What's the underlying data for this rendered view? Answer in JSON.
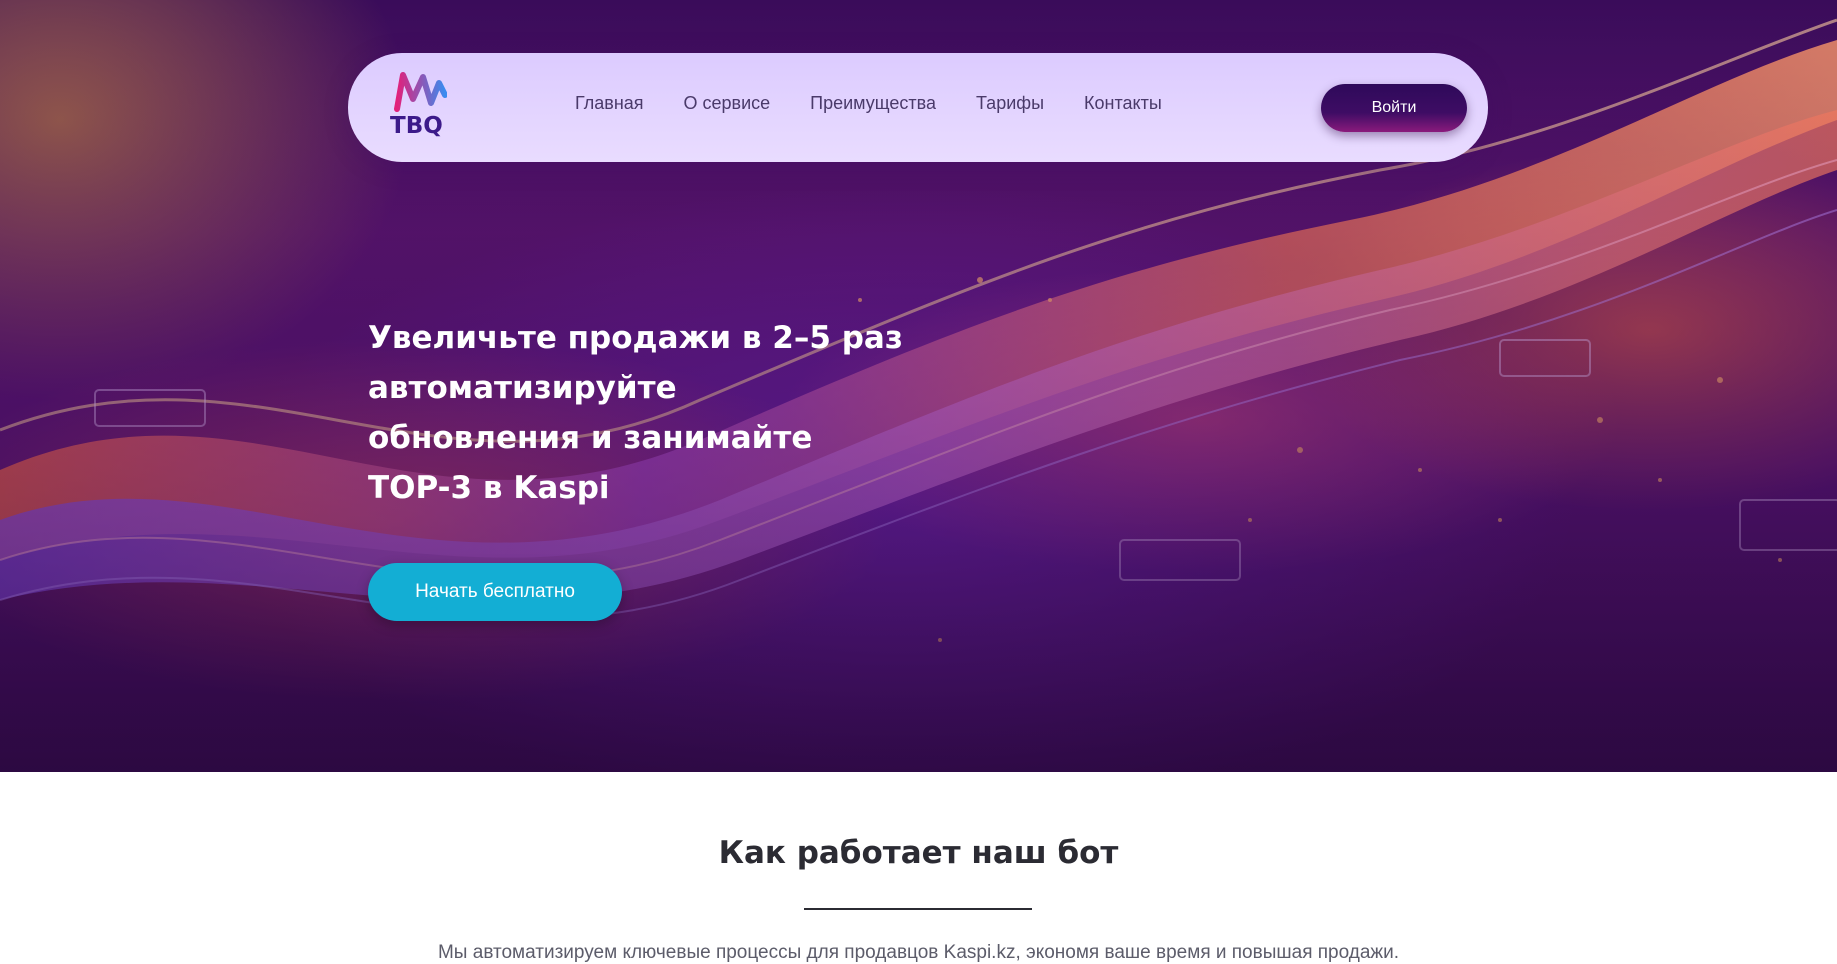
{
  "brand": {
    "logo_text": "TBQ",
    "colors": {
      "navy": "#3c1a8a",
      "cyan": "#13aed4",
      "magenta": "#e2207a"
    }
  },
  "nav": {
    "items": [
      {
        "label": "Главная"
      },
      {
        "label": "О сервисе"
      },
      {
        "label": "Преимущества"
      },
      {
        "label": "Тарифы"
      },
      {
        "label": "Контакты"
      }
    ],
    "login_label": "Войти"
  },
  "hero": {
    "title_lines": [
      "Увеличьте продажи в 2–5 раз",
      "автоматизируйте",
      "обновления и занимайте",
      "TOP-3 в Kaspi"
    ],
    "cta_label": "Начать бесплатно"
  },
  "section": {
    "title": "Как работает наш бот",
    "description": "Мы автоматизируем ключевые процессы для продавцов Kaspi.kz, экономя ваше время и повышая продажи."
  }
}
